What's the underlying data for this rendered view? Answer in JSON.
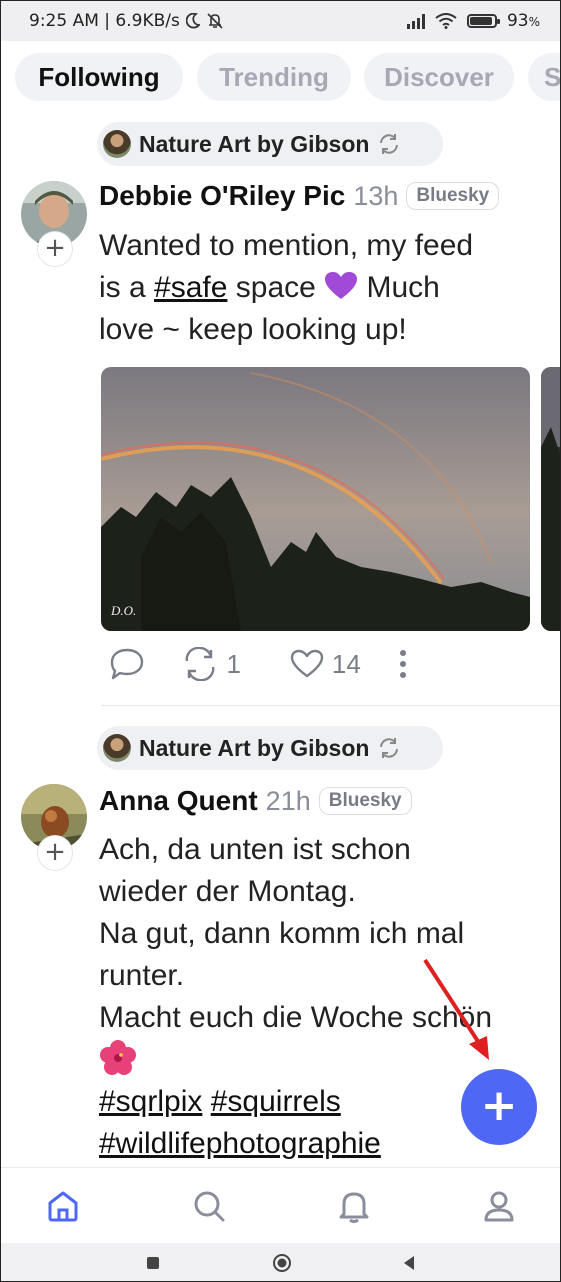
{
  "status_bar": {
    "time_speed": "9:25 AM | 6.9KB/s",
    "battery": "93",
    "battery_level": 0.93
  },
  "tabs": [
    {
      "label": "Following",
      "active": true
    },
    {
      "label": "Trending",
      "active": false
    },
    {
      "label": "Discover",
      "active": false
    },
    {
      "label": "S",
      "active": false
    }
  ],
  "posts": [
    {
      "feed_source": "Nature Art by Gibson",
      "author": "Debbie O'Riley Pic",
      "time": "13h",
      "badge": "Bluesky",
      "text_lines": [
        "Wanted to mention, my feed",
        "is a #safe space",
        "Much",
        "love ~ keep looking up!"
      ],
      "text_parts": {
        "pre_tag": "is a ",
        "tag": "#safe",
        "post_tag": " space "
      },
      "image_watermark": "D.O.",
      "reposts": "1",
      "likes": "14"
    },
    {
      "feed_source": "Nature Art by Gibson",
      "author": "Anna Quent",
      "time": "21h",
      "badge": "Bluesky",
      "text_lines": [
        "Ach, da unten ist schon",
        "wieder der Montag.",
        "Na gut, dann komm ich mal",
        "runter.",
        "Macht euch die Woche schön"
      ],
      "hashtags": [
        "#sqrlpix",
        "#squirrels",
        "#wildlifephotographie"
      ]
    }
  ],
  "fab": {
    "label": "+",
    "icon": "plus-icon"
  },
  "bottom_nav": [
    "home-icon",
    "search-icon",
    "bell-icon",
    "profile-icon"
  ],
  "colors": {
    "accent": "#4f67f5",
    "annotation_arrow": "#e02020"
  }
}
